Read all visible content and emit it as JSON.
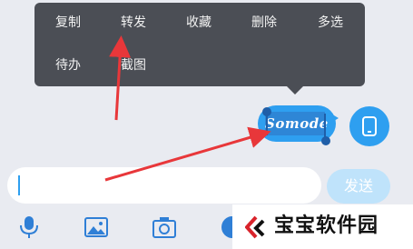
{
  "context_menu": {
    "items": [
      {
        "label": "复制"
      },
      {
        "label": "转发"
      },
      {
        "label": "收藏"
      },
      {
        "label": "删除"
      },
      {
        "label": "多选"
      },
      {
        "label": "待办"
      },
      {
        "label": "截图"
      }
    ]
  },
  "message": {
    "text": "Somode"
  },
  "composer": {
    "input_value": "",
    "send_label": "发送"
  },
  "toolbar": {
    "icons": [
      "microphone-icon",
      "image-icon",
      "camera-icon",
      "emoji-icon"
    ]
  },
  "watermark": {
    "text": "宝宝软件园"
  },
  "colors": {
    "menu_bg": "#4b4e55",
    "bubble": "#2e9ff0",
    "send_disabled": "#bfe3fb",
    "arrow": "#e8373a",
    "background": "#e9ebf1"
  }
}
